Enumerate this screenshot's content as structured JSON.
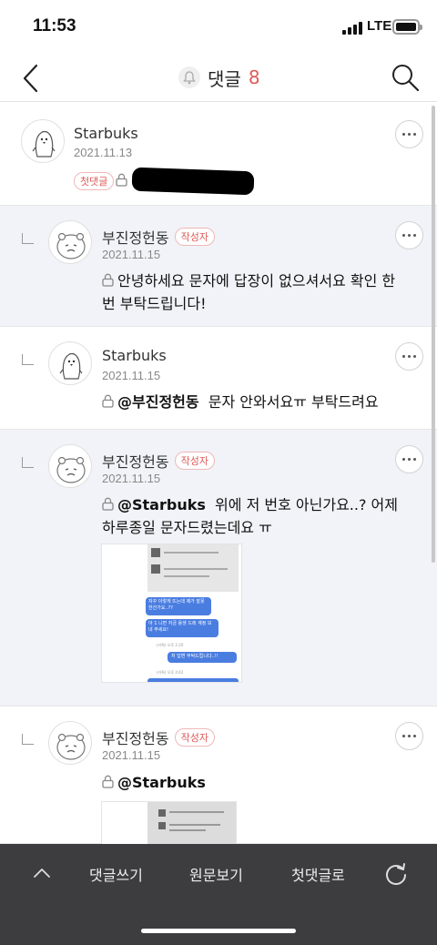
{
  "status": {
    "time": "11:53",
    "network": "LTE"
  },
  "header": {
    "title": "댓글",
    "count": "8"
  },
  "comments": [
    {
      "author": "Starbuks",
      "date": "2021.11.13",
      "first_badge": "첫댓글"
    },
    {
      "author": "부진정헌동",
      "badge": "작성자",
      "date": "2021.11.15",
      "text": "안녕하세요 문자에 답장이 없으셔서요 확인 한번 부탁드립니다!"
    },
    {
      "author": "Starbuks",
      "date": "2021.11.15",
      "mention": "@부진정헌동",
      "text": "문자 안와서요ㅠ 부탁드려요"
    },
    {
      "author": "부진정헌동",
      "badge": "작성자",
      "date": "2021.11.15",
      "mention": "@Starbuks",
      "text_line1": "위에 저 번호 아닌가요..? 어제",
      "text_line2": "하루종일 문자드렸는데요 ㅠ",
      "thumb": {
        "bubble1": "자꾸 이렇게 뜨는데 제가 잘못한건가요..??",
        "bubble2": "아 1 니면 지금 용생 드레 계정 보내 주세요!",
        "time1": "(카톡) 오후 2:20",
        "bubble3": "저 답변 부탁드립니다..!!",
        "time2": "(카톡) 오후 4:42"
      }
    },
    {
      "author": "부진정헌동",
      "badge": "작성자",
      "date": "2021.11.15",
      "mention": "@Starbuks"
    }
  ],
  "bottombar": {
    "write": "댓글쓰기",
    "original": "원문보기",
    "first": "첫댓글로"
  }
}
